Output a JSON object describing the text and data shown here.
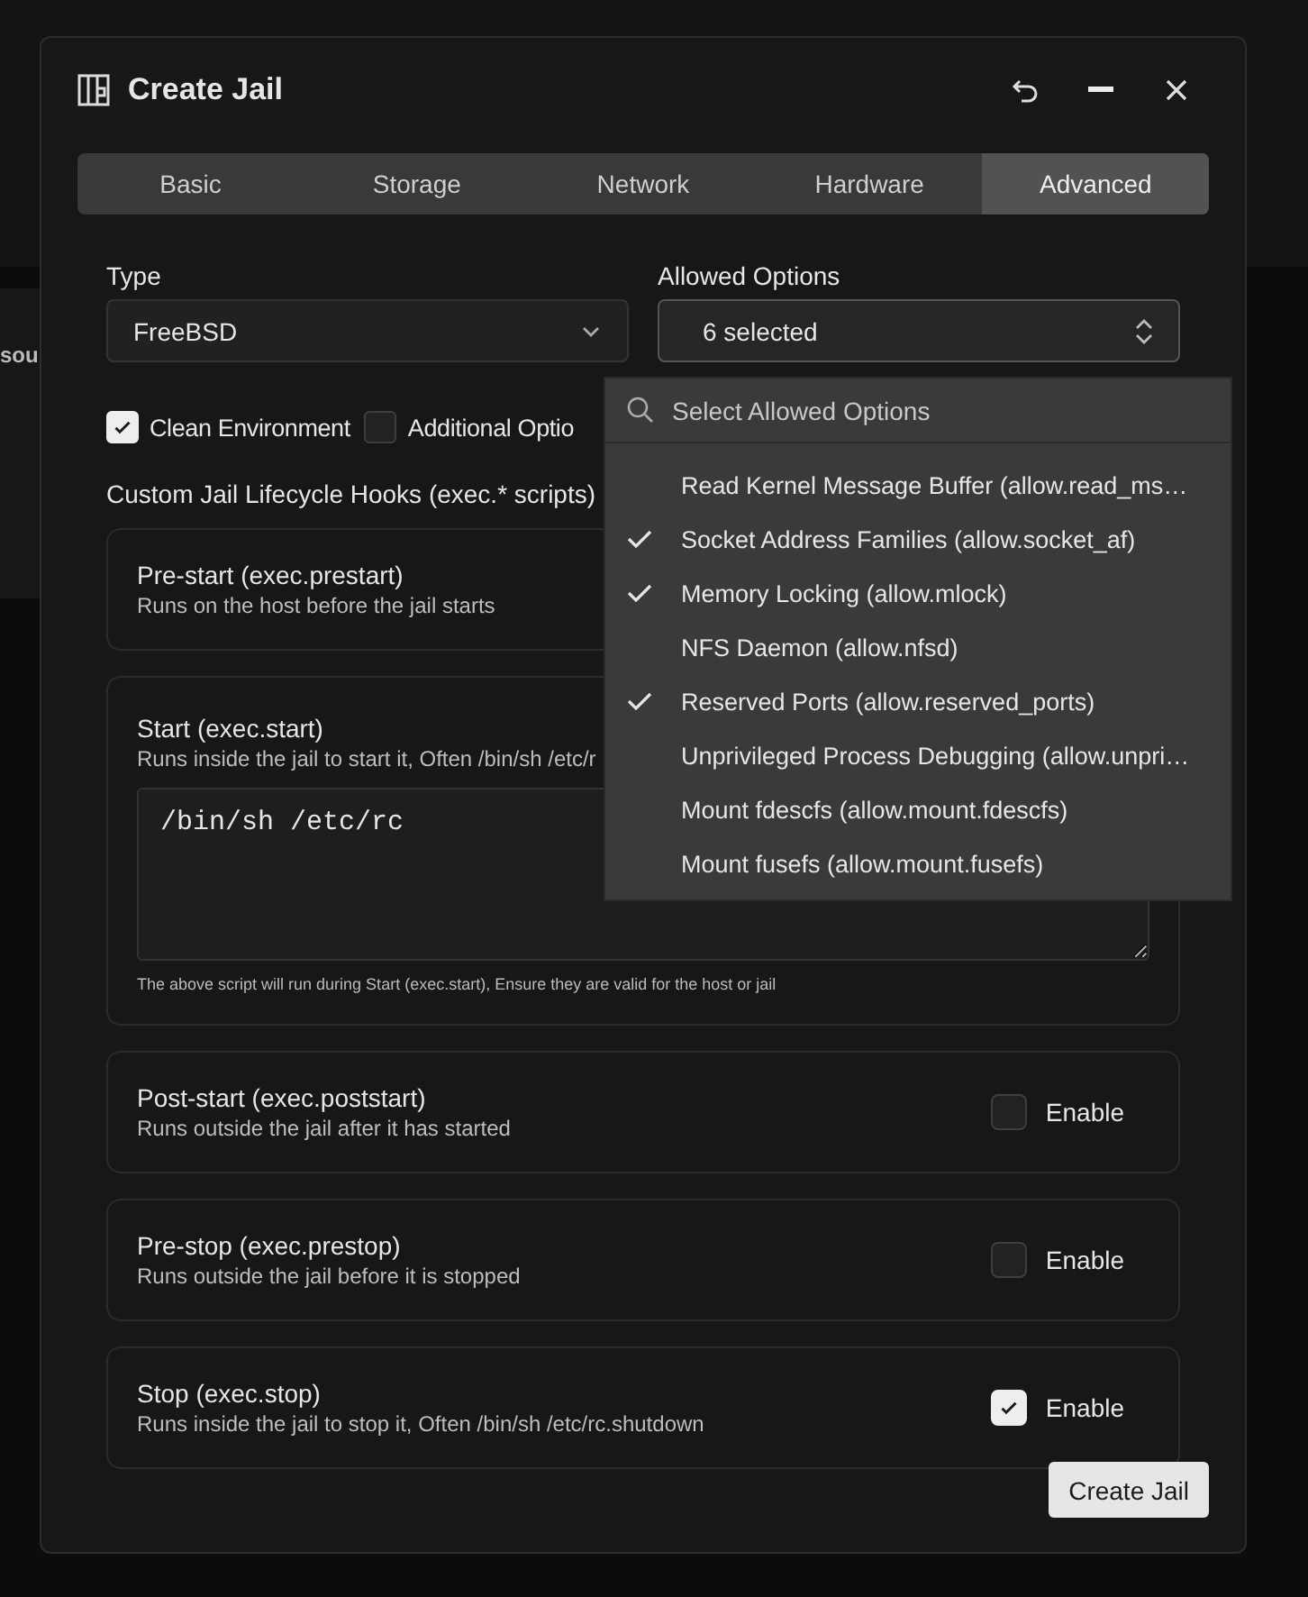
{
  "background_fragment": "sou",
  "window": {
    "title": "Create Jail"
  },
  "tabs": [
    {
      "label": "Basic",
      "selected": false
    },
    {
      "label": "Storage",
      "selected": false
    },
    {
      "label": "Network",
      "selected": false
    },
    {
      "label": "Hardware",
      "selected": false
    },
    {
      "label": "Advanced",
      "selected": true
    }
  ],
  "type_field": {
    "label": "Type",
    "value": "FreeBSD"
  },
  "allowed_options": {
    "label": "Allowed Options",
    "value": "6 selected",
    "expanded": true,
    "search_placeholder": "Select Allowed Options",
    "items": [
      {
        "label": "Read Kernel Message Buffer (allow.read_ms…",
        "selected": false
      },
      {
        "label": "Socket Address Families (allow.socket_af)",
        "selected": true
      },
      {
        "label": "Memory Locking (allow.mlock)",
        "selected": true
      },
      {
        "label": "NFS Daemon (allow.nfsd)",
        "selected": false
      },
      {
        "label": "Reserved Ports (allow.reserved_ports)",
        "selected": true
      },
      {
        "label": "Unprivileged Process Debugging (allow.unpri…",
        "selected": false
      },
      {
        "label": "Mount fdescfs (allow.mount.fdescfs)",
        "selected": false
      },
      {
        "label": "Mount fusefs (allow.mount.fusefs)",
        "selected": false
      }
    ]
  },
  "options": [
    {
      "label": "Clean Environment",
      "checked": true
    },
    {
      "label": "Additional Optio",
      "checked": false
    }
  ],
  "hooks_heading": "Custom Jail Lifecycle Hooks (exec.* scripts)",
  "hooks": [
    {
      "kind": "toggle",
      "title": "Pre-start (exec.prestart)",
      "description": "Runs on the host before the jail starts"
    },
    {
      "kind": "script",
      "title": "Start (exec.start)",
      "description": "Runs inside the jail to start it, Often /bin/sh /etc/r",
      "script": "/bin/sh /etc/rc",
      "note": "The above script will run during Start (exec.start), Ensure they are valid for the host or jail"
    },
    {
      "kind": "toggle",
      "title": "Post-start (exec.poststart)",
      "description": "Runs outside the jail after it has started",
      "enable_label": "Enable",
      "checked": false
    },
    {
      "kind": "toggle",
      "title": "Pre-stop (exec.prestop)",
      "description": "Runs outside the jail before it is stopped",
      "enable_label": "Enable",
      "checked": false
    },
    {
      "kind": "toggle",
      "title": "Stop (exec.stop)",
      "description": "Runs inside the jail to stop it, Often /bin/sh /etc/rc.shutdown",
      "enable_label": "Enable",
      "checked": true
    }
  ],
  "submit_button": "Create Jail"
}
